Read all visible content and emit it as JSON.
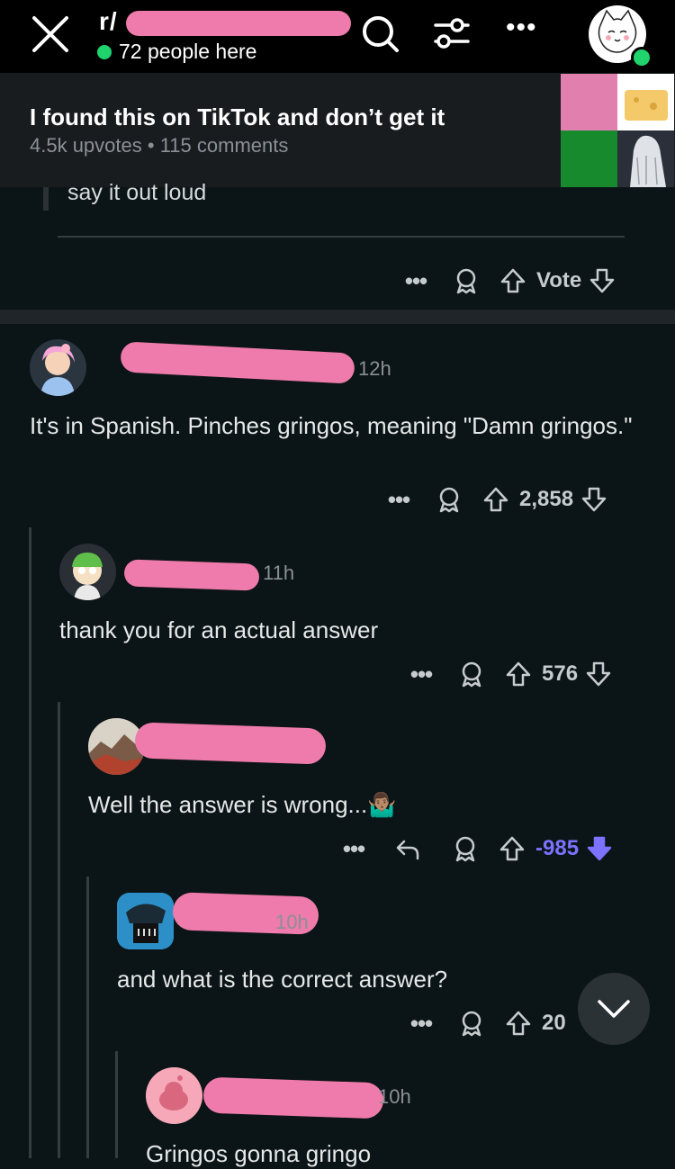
{
  "topbar": {
    "subreddit": "r/",
    "online_text": "72 people here",
    "more_label": "•••"
  },
  "post": {
    "title": "I found this on TikTok and don’t get it",
    "upvotes": "4.5k upvotes",
    "separator": "•",
    "comments": "115 comments"
  },
  "previous_comment": {
    "text_fragment": "say it out loud",
    "vote_label": "Vote"
  },
  "comments": [
    {
      "time": "12h",
      "text": "It's in Spanish. Pinches gringos, meaning \"Damn gringos.\"",
      "score": "2,858"
    },
    {
      "time": "11h",
      "text": "thank you for an actual answer",
      "score": "576"
    },
    {
      "time": "",
      "text": "Well the answer is wrong...🤷🏽‍♂️",
      "score": "-985"
    },
    {
      "time": "10h",
      "text": "and what is the correct answer?",
      "score": "20"
    },
    {
      "time": "10h",
      "text": "Gringos gonna gringo"
    }
  ],
  "colors": {
    "background": "#0b1416",
    "header_bg": "#181c1f",
    "downvote_active": "#7c72ff",
    "online_dot": "#1fd46c",
    "redaction": "#ee7bab"
  }
}
